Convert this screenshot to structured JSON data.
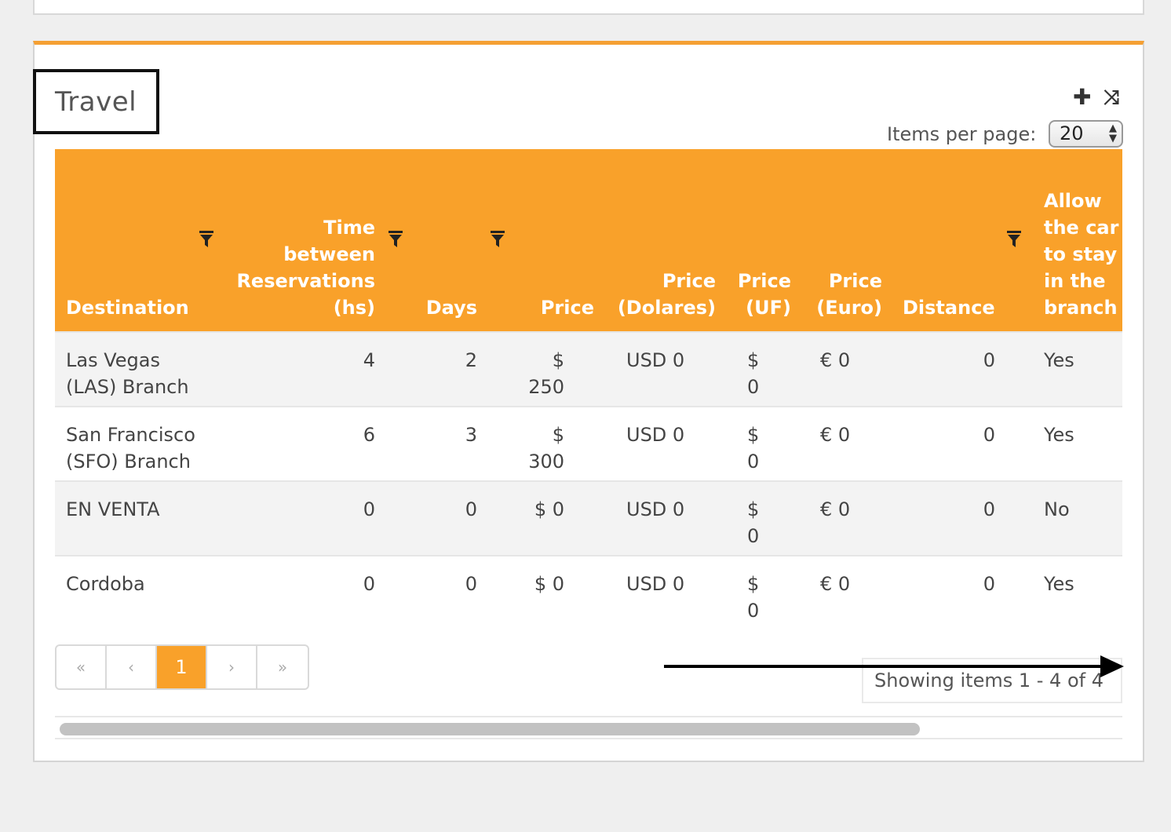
{
  "panel": {
    "title": "Travel",
    "add_icon": "plus-icon",
    "shuffle_icon": "shuffle-icon",
    "items_per_page_label": "Items per page:",
    "items_per_page_value": "20",
    "accent_color": "#f9a12a"
  },
  "table": {
    "columns": {
      "destination": "Destination",
      "time": "Time between Reservations (hs)",
      "days": "Days",
      "price": "Price",
      "price_usd": "Price (Dolares)",
      "price_uf": "Price (UF)",
      "price_euro": "Price (Euro)",
      "distance": "Distance",
      "allow": "Allow the car to stay in the branch"
    },
    "rows": [
      {
        "destination": "Las Vegas (LAS) Branch",
        "time": "4",
        "days": "2",
        "price": "$ 250",
        "price_usd": "USD 0",
        "price_uf": "$ 0",
        "price_euro": "€ 0",
        "distance": "0",
        "allow": "Yes"
      },
      {
        "destination": "San Francisco (SFO) Branch",
        "time": "6",
        "days": "3",
        "price": "$ 300",
        "price_usd": "USD 0",
        "price_uf": "$ 0",
        "price_euro": "€ 0",
        "distance": "0",
        "allow": "Yes"
      },
      {
        "destination": "EN VENTA",
        "time": "0",
        "days": "0",
        "price": "$ 0",
        "price_usd": "USD 0",
        "price_uf": "$ 0",
        "price_euro": "€ 0",
        "distance": "0",
        "allow": "No"
      },
      {
        "destination": "Cordoba",
        "time": "0",
        "days": "0",
        "price": "$ 0",
        "price_usd": "USD 0",
        "price_uf": "$ 0",
        "price_euro": "€ 0",
        "distance": "0",
        "allow": "Yes"
      }
    ]
  },
  "pager": {
    "first": "«",
    "prev": "‹",
    "current": "1",
    "next": "›",
    "last": "»",
    "status": "Showing items 1 - 4 of 4"
  }
}
